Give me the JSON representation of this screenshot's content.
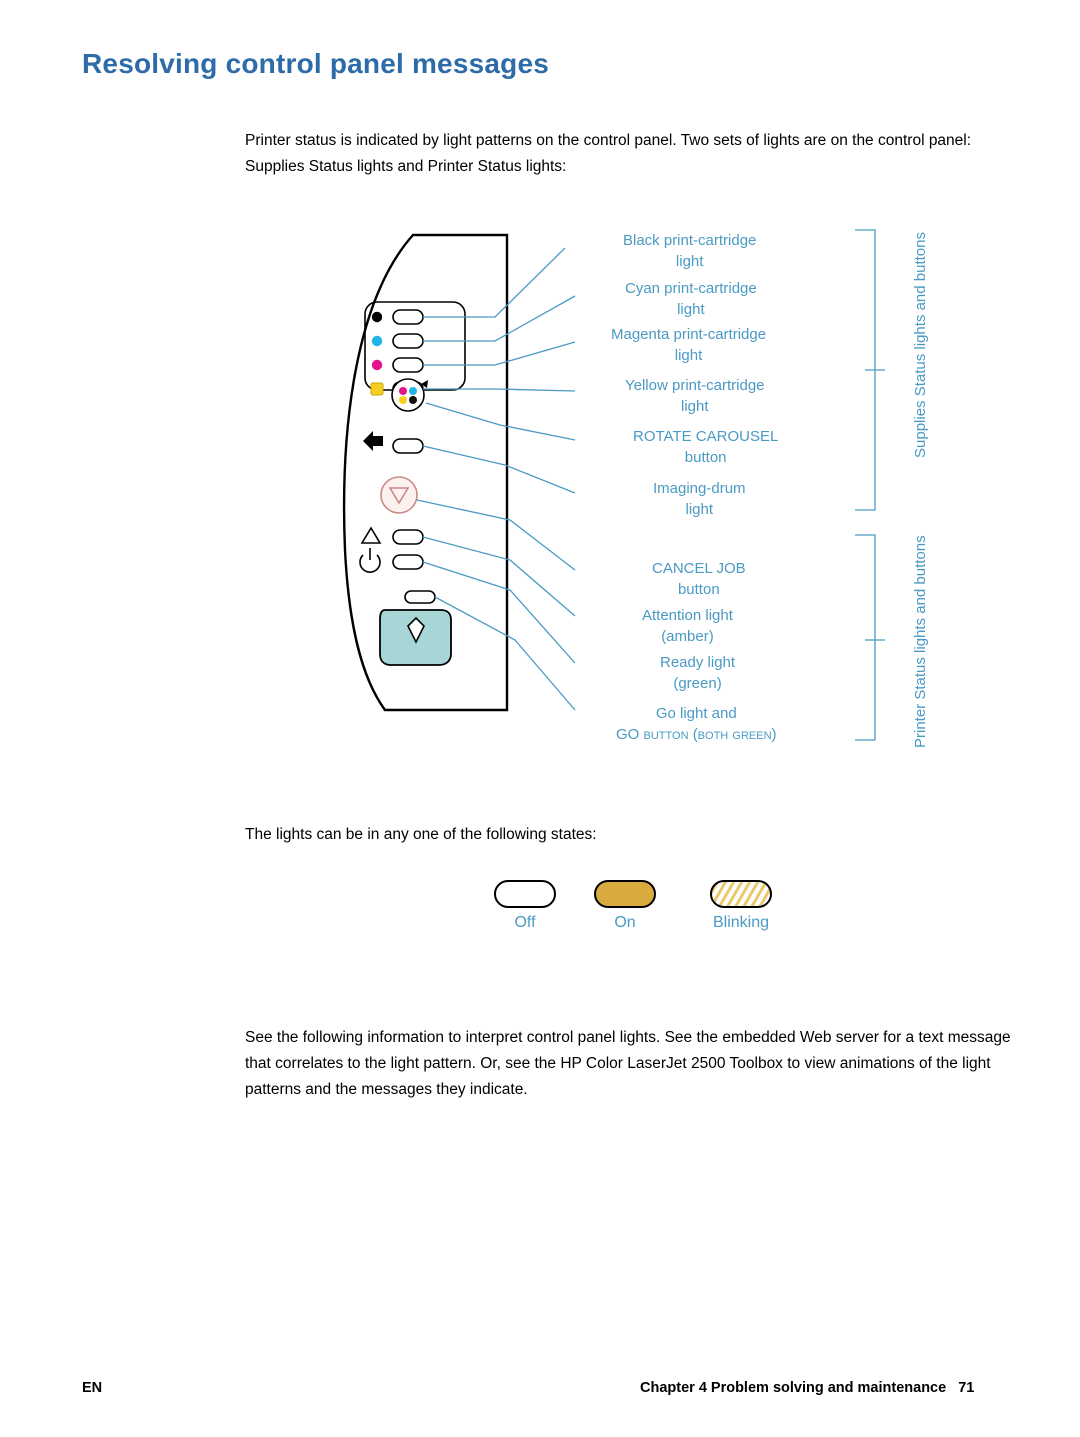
{
  "document": {
    "title": "Resolving control panel messages",
    "intro_paragraph": "Printer status is indicated by light patterns on the control panel. Two sets of lights are on the control panel: Supplies Status lights and Printer Status lights:",
    "states_paragraph": "The lights can be in any one of the following states:",
    "closing_paragraph": "See the following information to interpret control panel lights. See the embedded Web server for a text message that correlates to the light pattern. Or, see the HP Color LaserJet 2500 Toolbox to view animations of the light patterns and the messages they indicate."
  },
  "diagram": {
    "callouts": [
      {
        "line1": "Black print-cartridge",
        "line2": "light"
      },
      {
        "line1": "Cyan print-cartridge",
        "line2": "light"
      },
      {
        "line1": "Magenta print-cartridge",
        "line2": "light"
      },
      {
        "line1": "Yellow print-cartridge",
        "line2": "light"
      },
      {
        "line1": "ROTATE CAROUSEL",
        "line2": "button"
      },
      {
        "line1": "Imaging-drum",
        "line2": "light"
      },
      {
        "line1": "CANCEL JOB",
        "line2": "button"
      },
      {
        "line1": "Attention light",
        "line2": "(amber)"
      },
      {
        "line1": "Ready light",
        "line2": "(green)"
      },
      {
        "line1": "Go light and",
        "line2": "GO button (both green)"
      }
    ],
    "brackets": [
      {
        "label": "Supplies Status lights and buttons"
      },
      {
        "label": "Printer Status lights and buttons"
      }
    ]
  },
  "legend": {
    "items": [
      {
        "label": "Off",
        "state": "off"
      },
      {
        "label": "On",
        "state": "on"
      },
      {
        "label": "Blinking",
        "state": "blinking"
      }
    ]
  },
  "footer": {
    "language": "EN",
    "chapter": "Chapter 4  Problem solving and maintenance",
    "page_number": "71"
  },
  "colors": {
    "heading": "#2d6ca8",
    "callout": "#4a9ac4",
    "lamp_on": "#d9ab3f",
    "go_button": "#a8d5d5"
  }
}
